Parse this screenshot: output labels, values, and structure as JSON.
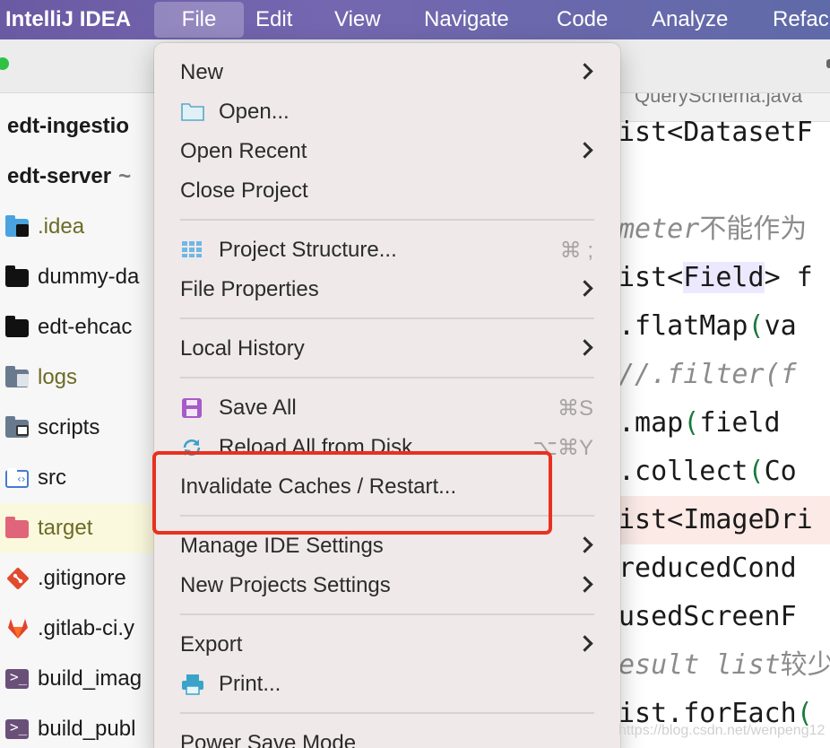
{
  "menubar": {
    "app_name": "IntelliJ IDEA",
    "items": [
      "File",
      "Edit",
      "View",
      "Navigate",
      "Code",
      "Analyze",
      "Refac"
    ]
  },
  "tree": {
    "rows": [
      {
        "label": "edt-ingestio",
        "suffix": ""
      },
      {
        "label": "edt-server",
        "suffix": "~"
      },
      {
        "label": ".idea"
      },
      {
        "label": "dummy-da"
      },
      {
        "label": "edt-ehcac"
      },
      {
        "label": "logs"
      },
      {
        "label": "scripts"
      },
      {
        "label": "src"
      },
      {
        "label": "target"
      },
      {
        "label": ".gitignore"
      },
      {
        "label": ".gitlab-ci.y"
      },
      {
        "label": "build_imag"
      },
      {
        "label": "build_publ"
      }
    ]
  },
  "editor": {
    "tab_text": "QuerySchema.java",
    "lines": [
      {
        "a": "ist<DatasetF"
      },
      {
        "a": "meter",
        "b": "不能作为"
      },
      {
        "a": "ist<",
        "b": "Field",
        "c": "> f"
      },
      {
        "a": "  .flatMap",
        "b": "(",
        "c": "va"
      },
      {
        "a": "  //.filter(f"
      },
      {
        "a": "  .map",
        "b": "(",
        "c": "field"
      },
      {
        "a": "  .collect",
        "b": "(",
        "c": "Co"
      },
      {
        "a": "ist<ImageDri"
      },
      {
        "a": "  reducedCond"
      },
      {
        "a": "  usedScreenF"
      },
      {
        "a": "esult list",
        "b": "较少"
      },
      {
        "a": "ist.forEach",
        "b": "("
      }
    ]
  },
  "file_menu": {
    "items": [
      {
        "label": "New"
      },
      {
        "label": "Open..."
      },
      {
        "label": "Open Recent"
      },
      {
        "label": "Close Project"
      },
      {
        "label": "Project Structure...",
        "shortcut": "⌘ ;"
      },
      {
        "label": "File Properties"
      },
      {
        "label": "Local History"
      },
      {
        "label": "Save All",
        "shortcut": "⌘S"
      },
      {
        "label": "Reload All from Disk",
        "shortcut": "⌥⌘Y"
      },
      {
        "label": "Invalidate Caches / Restart..."
      },
      {
        "label": "Manage IDE Settings"
      },
      {
        "label": "New Projects Settings"
      },
      {
        "label": "Export"
      },
      {
        "label": "Print..."
      },
      {
        "label": "Power Save Mode"
      }
    ]
  },
  "watermark": "https://blog.csdn.net/wenpeng12",
  "colors": {
    "menubar": "#6a5aa3",
    "menu_bg": "#f0e9e9",
    "highlight_box": "#e8311f"
  }
}
